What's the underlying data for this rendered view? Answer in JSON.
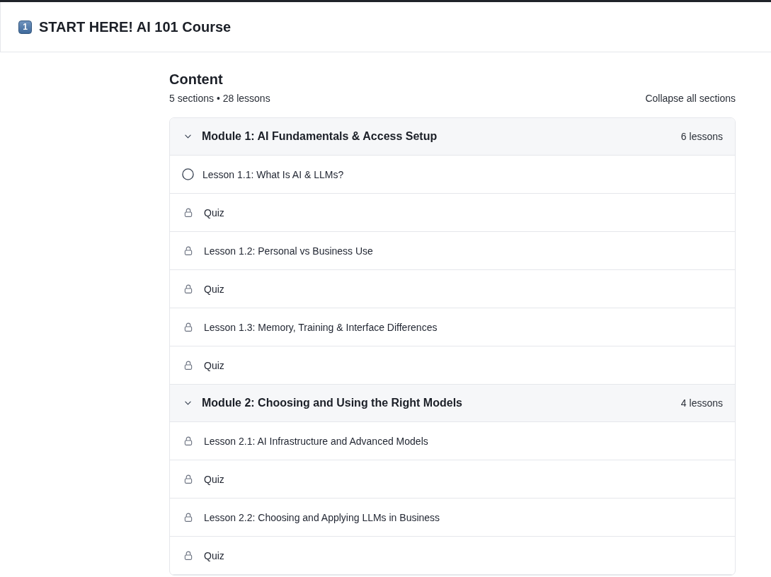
{
  "header": {
    "keycap": "1",
    "title": "START HERE! AI 101 Course"
  },
  "content": {
    "title": "Content",
    "summary": "5 sections • 28 lessons",
    "collapse_all": "Collapse all sections"
  },
  "modules": [
    {
      "title": "Module 1: AI Fundamentals & Access Setup",
      "count": "6 lessons",
      "expanded": true,
      "lessons": [
        {
          "title": "Lesson 1.1: What Is AI & LLMs?",
          "locked": false
        },
        {
          "title": "Quiz",
          "locked": true
        },
        {
          "title": "Lesson 1.2: Personal vs Business Use",
          "locked": true
        },
        {
          "title": "Quiz",
          "locked": true
        },
        {
          "title": "Lesson 1.3: Memory, Training & Interface Differences",
          "locked": true
        },
        {
          "title": "Quiz",
          "locked": true
        }
      ]
    },
    {
      "title": "Module 2: Choosing and Using the Right Models",
      "count": "4 lessons",
      "expanded": true,
      "lessons": [
        {
          "title": "Lesson 2.1: AI Infrastructure and Advanced Models",
          "locked": true
        },
        {
          "title": "Quiz",
          "locked": true
        },
        {
          "title": "Lesson 2.2: Choosing and Applying LLMs in Business",
          "locked": true
        },
        {
          "title": "Quiz",
          "locked": true
        }
      ]
    }
  ]
}
